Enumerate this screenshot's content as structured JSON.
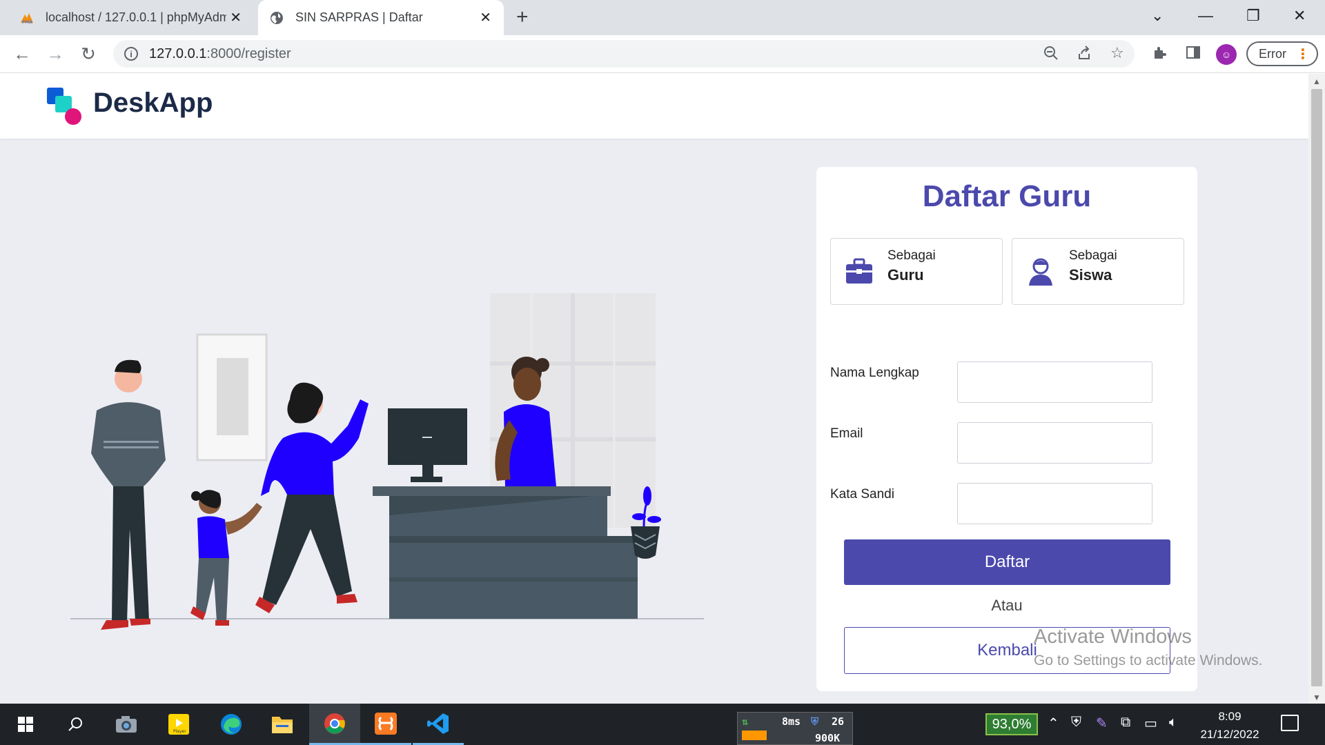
{
  "browser": {
    "tabs": [
      {
        "title": "localhost / 127.0.0.1 | phpMyAdmin",
        "favicon": "phpmyadmin-icon"
      },
      {
        "title": "SIN SARPRAS | Daftar",
        "favicon": "globe-icon"
      }
    ],
    "url_host": "127.0.0.1",
    "url_path": ":8000/register",
    "profile_button": "Error"
  },
  "header": {
    "brand": "DeskApp",
    "logo_colors": [
      "#0b5cd5",
      "#1dd1c9",
      "#e0157a"
    ]
  },
  "register": {
    "title": "Daftar Guru",
    "roles": [
      {
        "prefix": "Sebagai",
        "label": "Guru",
        "icon": "briefcase-icon"
      },
      {
        "prefix": "Sebagai",
        "label": "Siswa",
        "icon": "student-icon"
      }
    ],
    "fields": [
      {
        "label": "Nama Lengkap",
        "value": ""
      },
      {
        "label": "Email",
        "value": ""
      },
      {
        "label": "Kata Sandi",
        "value": ""
      }
    ],
    "submit_label": "Daftar",
    "or_text": "Atau",
    "back_label": "Kembali",
    "accent_color": "#4b49ac"
  },
  "watermark": {
    "line1": "Activate Windows",
    "line2": "Go to Settings to activate Windows."
  },
  "taskbar": {
    "net_ping": "8ms",
    "net_count": "26",
    "net_speed": "900K",
    "battery": "93,0%",
    "time": "8:09",
    "date": "21/12/2022"
  }
}
